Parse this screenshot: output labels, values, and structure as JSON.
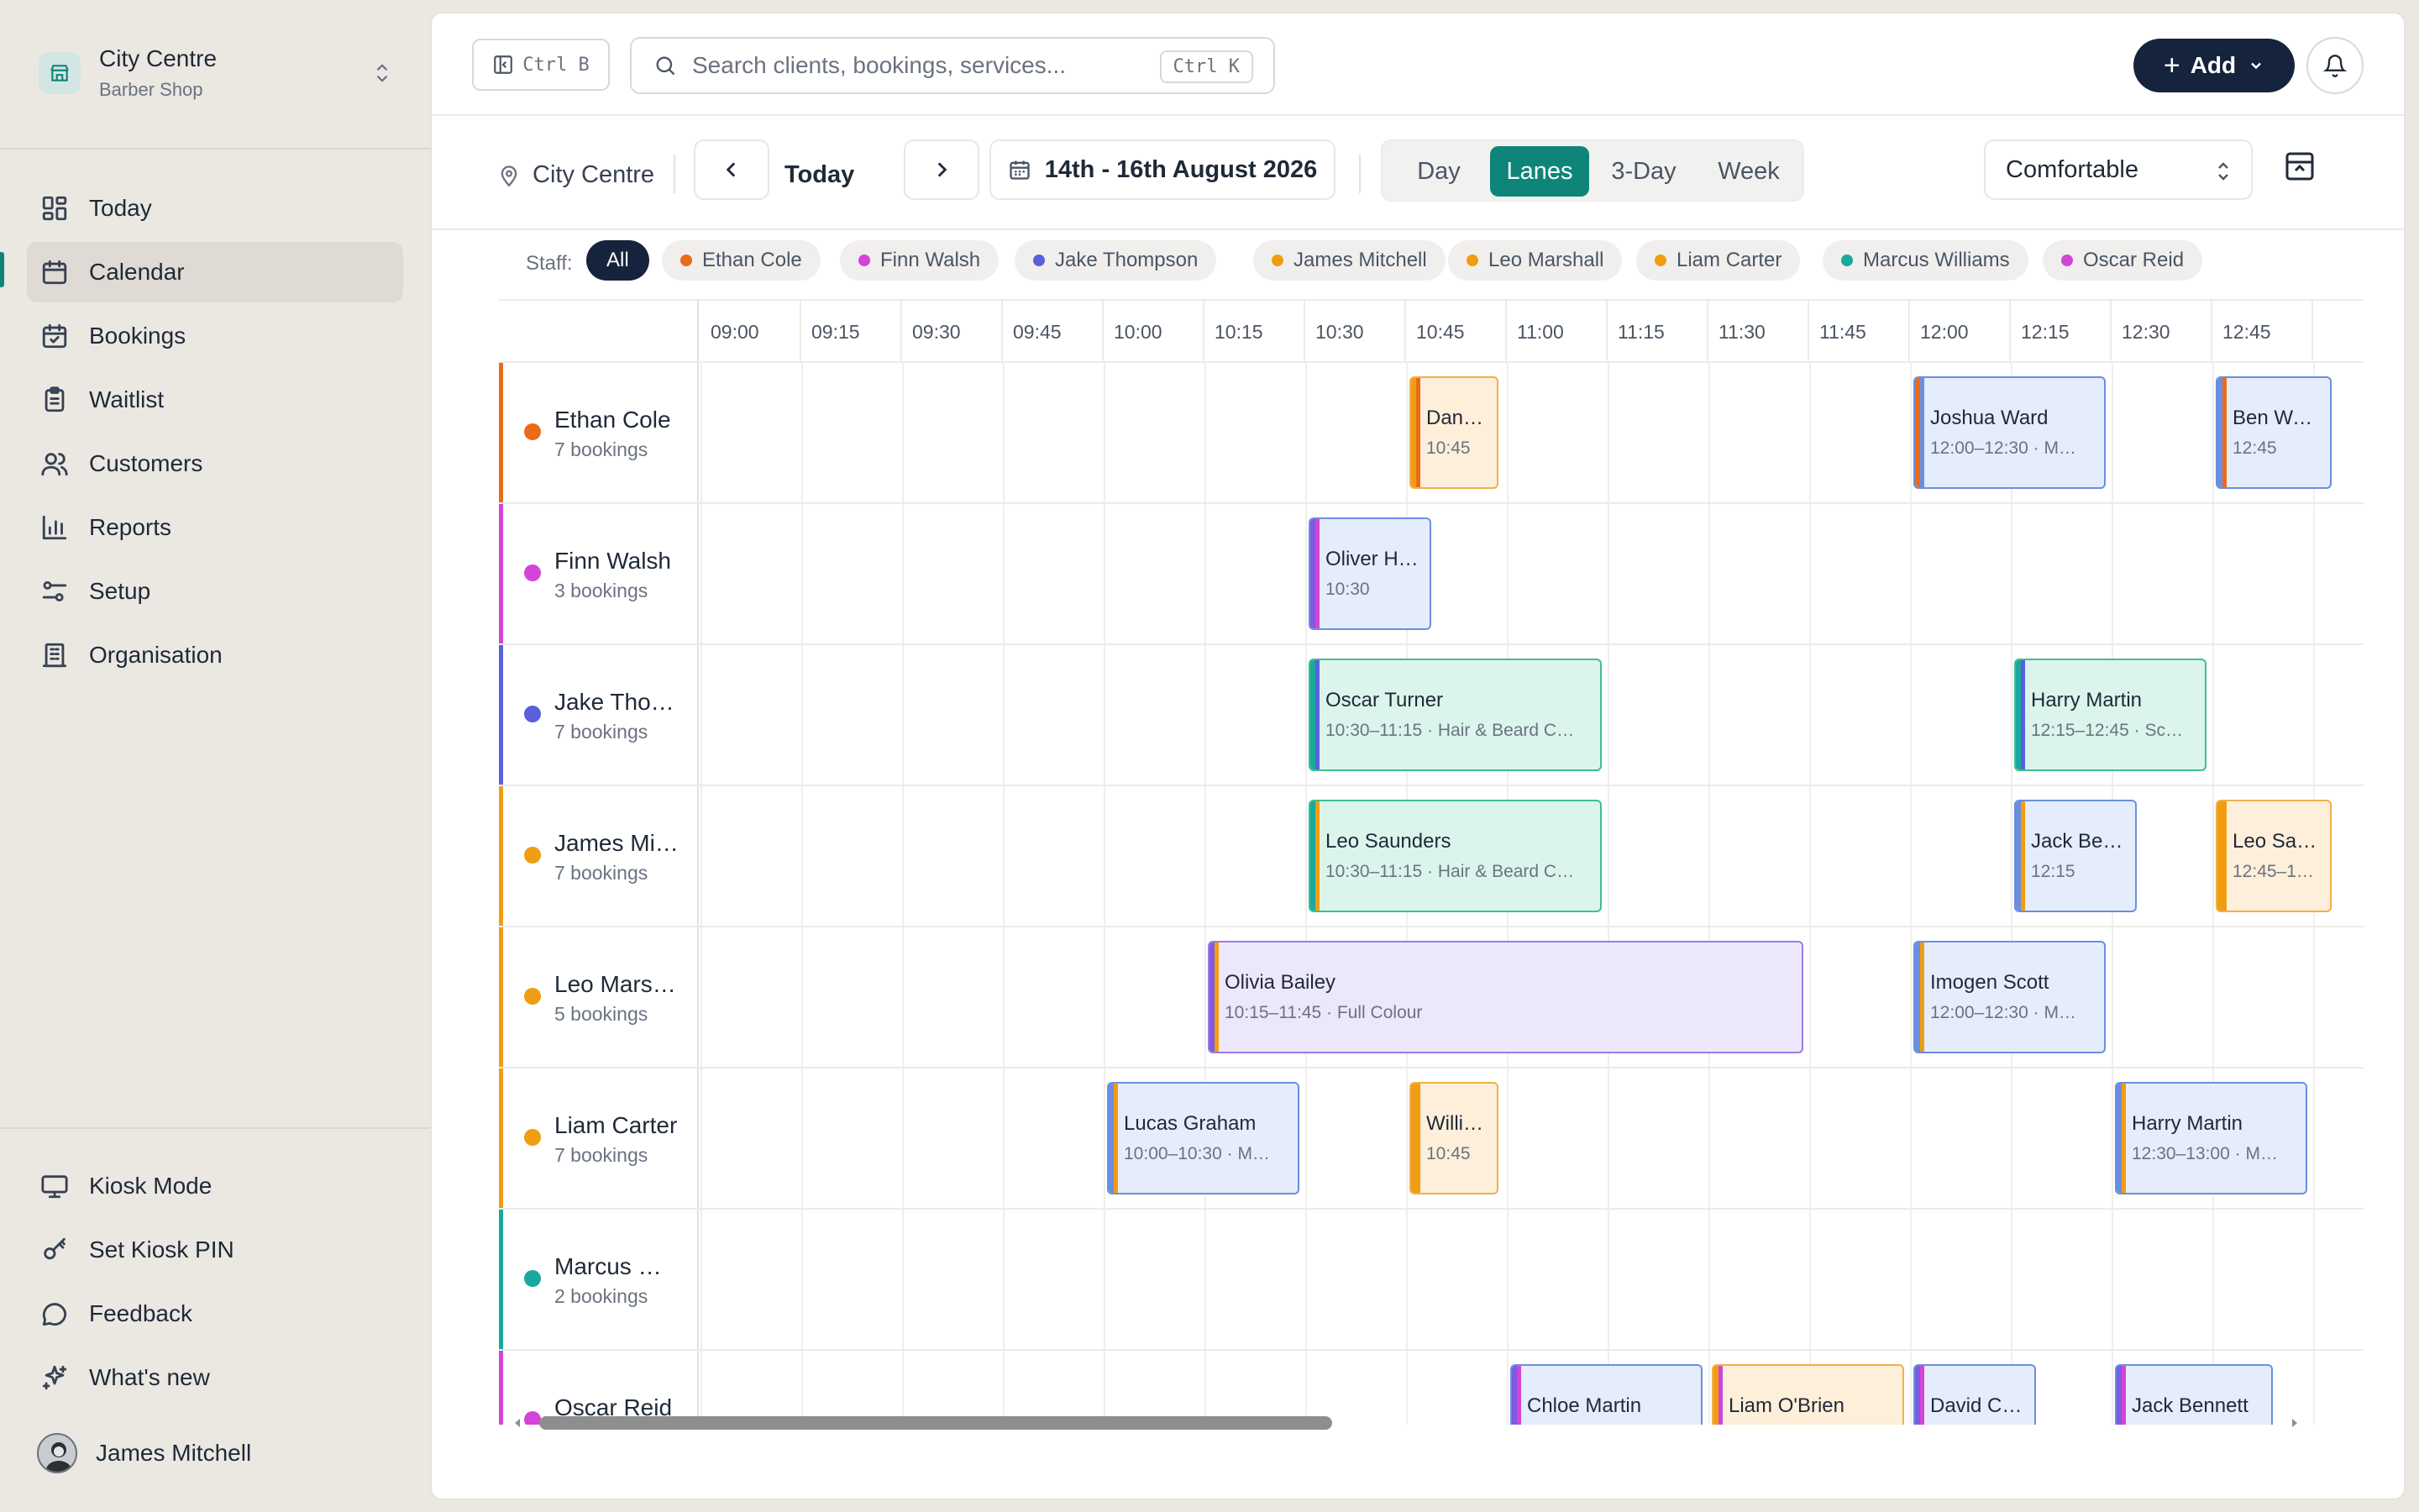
{
  "org": {
    "name": "City Centre",
    "type": "Barber Shop"
  },
  "nav": [
    {
      "label": "Today",
      "icon": "dashboard-icon"
    },
    {
      "label": "Calendar",
      "icon": "calendar-icon",
      "active": true
    },
    {
      "label": "Bookings",
      "icon": "calendar-check-icon"
    },
    {
      "label": "Waitlist",
      "icon": "clipboard-list-icon"
    },
    {
      "label": "Customers",
      "icon": "users-icon"
    },
    {
      "label": "Reports",
      "icon": "bar-chart-icon"
    },
    {
      "label": "Setup",
      "icon": "sliders-icon"
    },
    {
      "label": "Organisation",
      "icon": "building-icon"
    }
  ],
  "bottom_nav": [
    {
      "label": "Kiosk Mode",
      "icon": "monitor-icon"
    },
    {
      "label": "Set Kiosk PIN",
      "icon": "key-icon"
    },
    {
      "label": "Feedback",
      "icon": "message-circle-icon"
    },
    {
      "label": "What's new",
      "icon": "sparkles-icon"
    }
  ],
  "user": {
    "name": "James Mitchell"
  },
  "topbar": {
    "collapse_shortcut": "Ctrl B",
    "search_placeholder": "Search clients, bookings, services...",
    "search_shortcut": "Ctrl K",
    "add_label": "Add"
  },
  "toolbar": {
    "location": "City Centre",
    "today": "Today",
    "date_range": "14th - 16th August 2026",
    "views": [
      "Day",
      "Lanes",
      "3-Day",
      "Week"
    ],
    "active_view": "Lanes",
    "density": "Comfortable"
  },
  "filter": {
    "label": "Staff:",
    "all": "All",
    "staff": [
      {
        "name": "Ethan Cole",
        "color": "#ea6c1a"
      },
      {
        "name": "Finn Walsh",
        "color": "#d444d8"
      },
      {
        "name": "Jake Thompson",
        "color": "#5b5fdc"
      },
      {
        "name": "James Mitchell",
        "color": "#f09d12"
      },
      {
        "name": "Leo Marshall",
        "color": "#f09d12"
      },
      {
        "name": "Liam Carter",
        "color": "#f09d12"
      },
      {
        "name": "Marcus Williams",
        "color": "#19a99c"
      },
      {
        "name": "Oscar Reid",
        "color": "#d444d8"
      }
    ]
  },
  "times": [
    "09:00",
    "09:15",
    "09:30",
    "09:45",
    "10:00",
    "10:15",
    "10:30",
    "10:45",
    "11:00",
    "11:15",
    "11:30",
    "11:45",
    "12:00",
    "12:15",
    "12:30",
    "12:45"
  ],
  "lanes": [
    {
      "name": "Ethan Cole",
      "count": "7 bookings",
      "color": "#ea6c1a"
    },
    {
      "name": "Finn Walsh",
      "count": "3 bookings",
      "color": "#d444d8"
    },
    {
      "name": "Jake Tho…",
      "count": "7 bookings",
      "color": "#5b5fdc"
    },
    {
      "name": "James Mi…",
      "count": "7 bookings",
      "color": "#f09d12"
    },
    {
      "name": "Leo Mars…",
      "count": "5 bookings",
      "color": "#f09d12"
    },
    {
      "name": "Liam Carter",
      "count": "7 bookings",
      "color": "#f09d12"
    },
    {
      "name": "Marcus …",
      "count": "2 bookings",
      "color": "#19a99c"
    },
    {
      "name": "Oscar Reid",
      "count": "",
      "color": "#d444d8"
    }
  ],
  "bookings": [
    {
      "lane": 0,
      "start": "10:45",
      "slots": 0.93,
      "name": "Dan…",
      "sub": "10:45",
      "style": "orange",
      "c1": "#f09d12",
      "c2": "#ea6c1a"
    },
    {
      "lane": 0,
      "start": "12:00",
      "slots": 1.96,
      "name": "Joshua Ward",
      "sub": "12:00–12:30 · M…",
      "style": "blue",
      "c1": "#ea6c1a",
      "c2": "#6b8fe0"
    },
    {
      "lane": 0,
      "start": "12:45",
      "slots": 1.2,
      "name": "Ben Wa…",
      "sub": "12:45",
      "style": "blue",
      "c1": "#6b8fe0",
      "c2": "#ea6c1a"
    },
    {
      "lane": 1,
      "start": "10:30",
      "slots": 1.27,
      "name": "Oliver H…",
      "sub": "10:30",
      "style": "blue",
      "c1": "#7e5be0",
      "c2": "#d444d8"
    },
    {
      "lane": 2,
      "start": "10:30",
      "slots": 2.96,
      "name": "Oscar Turner",
      "sub": "10:30–11:15 · Hair & Beard C…",
      "style": "green",
      "c1": "#19a99c",
      "c2": "#5b5fdc"
    },
    {
      "lane": 2,
      "start": "12:15",
      "slots": 1.96,
      "name": "Harry Martin",
      "sub": "12:15–12:45 · Sc…",
      "style": "green",
      "c1": "#19a99c",
      "c2": "#5b5fdc"
    },
    {
      "lane": 3,
      "start": "10:30",
      "slots": 2.96,
      "name": "Leo Saunders",
      "sub": "10:30–11:15 · Hair & Beard C…",
      "style": "green",
      "c1": "#19a99c",
      "c2": "#f09d12"
    },
    {
      "lane": 3,
      "start": "12:15",
      "slots": 1.27,
      "name": "Jack Be…",
      "sub": "12:15",
      "style": "blue",
      "c1": "#6b8fe0",
      "c2": "#f09d12"
    },
    {
      "lane": 3,
      "start": "12:45",
      "slots": 1.2,
      "name": "Leo Saun…",
      "sub": "12:45–13:…",
      "style": "orange",
      "c1": "#f09d12",
      "c2": "#f09d12"
    },
    {
      "lane": 4,
      "start": "10:15",
      "slots": 5.96,
      "name": "Olivia Bailey",
      "sub": "10:15–11:45 · Full Colour",
      "style": "purple",
      "c1": "#7e5be0",
      "c2": "#f09d12"
    },
    {
      "lane": 4,
      "start": "12:00",
      "slots": 1.96,
      "name": "Imogen Scott",
      "sub": "12:00–12:30 · M…",
      "style": "blue",
      "c1": "#6b8fe0",
      "c2": "#f09d12"
    },
    {
      "lane": 5,
      "start": "10:00",
      "slots": 1.96,
      "name": "Lucas Graham",
      "sub": "10:00–10:30 · M…",
      "style": "blue",
      "c1": "#6b8fe0",
      "c2": "#f09d12"
    },
    {
      "lane": 5,
      "start": "10:45",
      "slots": 0.93,
      "name": "Willi…",
      "sub": "10:45",
      "style": "orange",
      "c1": "#f09d12",
      "c2": "#f09d12"
    },
    {
      "lane": 5,
      "start": "12:30",
      "slots": 1.96,
      "name": "Harry Martin",
      "sub": "12:30–13:00 · M…",
      "style": "blue",
      "c1": "#6b8fe0",
      "c2": "#f09d12"
    },
    {
      "lane": 7,
      "start": "11:00",
      "slots": 1.96,
      "name": "Chloe Martin",
      "sub": "",
      "style": "blue",
      "c1": "#7e5be0",
      "c2": "#d444d8"
    },
    {
      "lane": 7,
      "start": "11:30",
      "slots": 1.96,
      "name": "Liam O'Brien",
      "sub": "",
      "style": "orange",
      "c1": "#f09d12",
      "c2": "#d444d8"
    },
    {
      "lane": 7,
      "start": "12:00",
      "slots": 1.27,
      "name": "David C…",
      "sub": "",
      "style": "blue",
      "c1": "#7e5be0",
      "c2": "#d444d8"
    },
    {
      "lane": 7,
      "start": "12:30",
      "slots": 1.62,
      "name": "Jack Bennett",
      "sub": "",
      "style": "blue",
      "c1": "#7e5be0",
      "c2": "#d444d8"
    }
  ]
}
